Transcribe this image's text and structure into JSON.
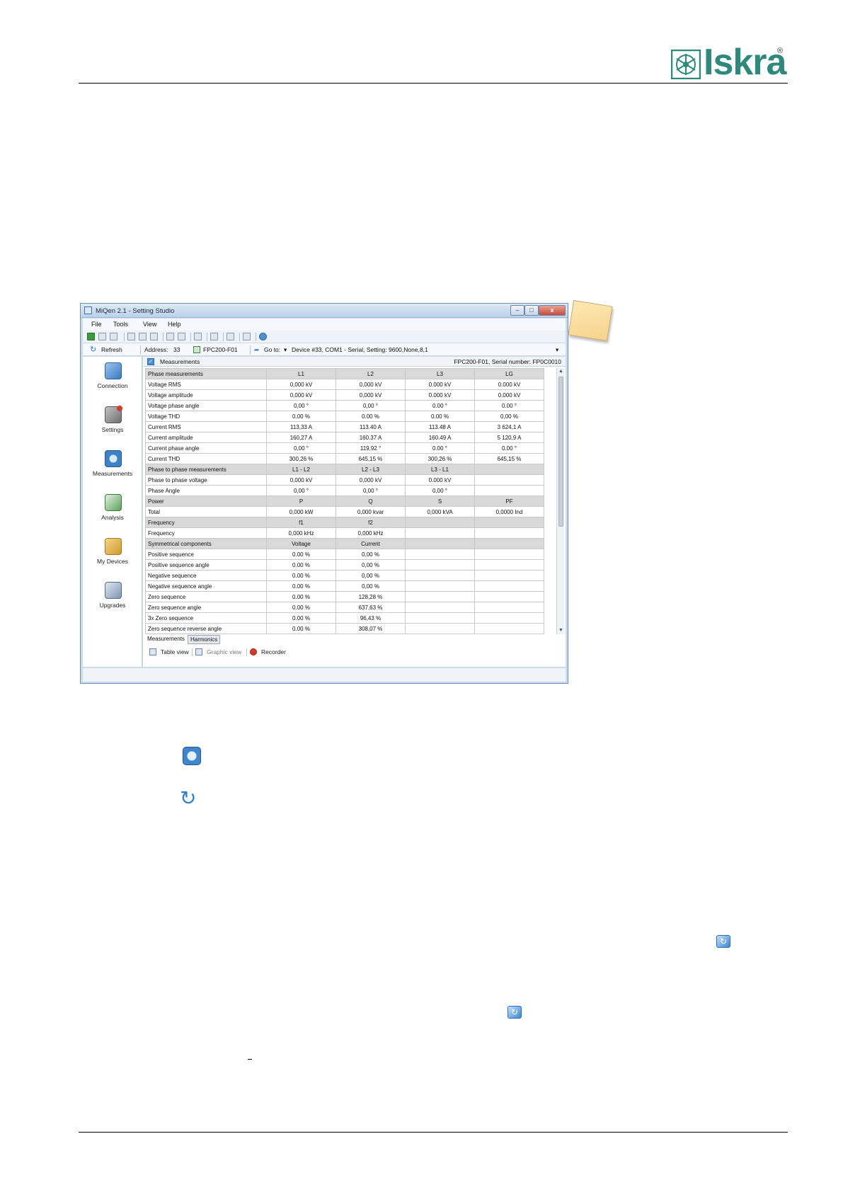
{
  "brand": {
    "name": "Iskra",
    "registered": "®",
    "color": "#2d8a7a"
  },
  "window": {
    "title": "MiQen 2.1 - Setting Studio",
    "buttons": {
      "minimize": "–",
      "maximize": "□",
      "close": "x"
    }
  },
  "menu": [
    "File",
    "Tools",
    "View",
    "Help"
  ],
  "addressbar": {
    "refresh": "Refresh",
    "address_label": "Address:",
    "address_value": "33",
    "device": "FPC200-F01",
    "goto_label": "Go to:",
    "goto_value": "Device #33, COM1 - Serial, Setting: 9600,None,8,1"
  },
  "sidebar": [
    {
      "label": "Connection",
      "icon": "connection-icon"
    },
    {
      "label": "Settings",
      "icon": "settings-icon"
    },
    {
      "label": "Measurements",
      "icon": "measurements-icon"
    },
    {
      "label": "Analysis",
      "icon": "analysis-icon"
    },
    {
      "label": "My Devices",
      "icon": "my-devices-icon"
    },
    {
      "label": "Upgrades",
      "icon": "upgrades-icon"
    }
  ],
  "panel": {
    "title": "Measurements",
    "serial": "FPC200-F01, Serial number: FP0C0010"
  },
  "table": {
    "rows": [
      {
        "type": "header",
        "cells": [
          "Phase measurements",
          "L1",
          "L2",
          "L3",
          "LG"
        ]
      },
      {
        "type": "data",
        "cells": [
          "Voltage RMS",
          "0,000 kV",
          "0,000 kV",
          "0.000 kV",
          "0.000 kV"
        ]
      },
      {
        "type": "data",
        "cells": [
          "Voltage amplitude",
          "0,000 kV",
          "0,000 kV",
          "0.000 kV",
          "0.000 kV"
        ]
      },
      {
        "type": "data",
        "cells": [
          "Voltage phase angle",
          "0,00 °",
          "0,00 °",
          "0.00 °",
          "0.00 °"
        ]
      },
      {
        "type": "data",
        "cells": [
          "Voltage THD",
          "0.00 %",
          "0.00 %",
          "0.00 %",
          "0,00 %"
        ]
      },
      {
        "type": "data",
        "cells": [
          "Current RMS",
          "113,33  A",
          "113.40  A",
          "113.48  A",
          "3 624,1  A"
        ]
      },
      {
        "type": "data",
        "cells": [
          "Current amplitude",
          "160,27  A",
          "160.37  A",
          "160.49  A",
          "5 120,9  A"
        ]
      },
      {
        "type": "data",
        "cells": [
          "Current phase angle",
          "0,00 °",
          "119,92 °",
          "0.00 °",
          "0.00 °"
        ]
      },
      {
        "type": "data",
        "cells": [
          "Current THD",
          "300,26 %",
          "645,15 %",
          "300,26 %",
          "645,15 %"
        ]
      },
      {
        "type": "header",
        "cells": [
          "Phase to phase measurements",
          "L1 - L2",
          "L2 - L3",
          "L3 - L1",
          ""
        ]
      },
      {
        "type": "data",
        "cells": [
          "Phase to phase voltage",
          "0,000 kV",
          "0,000 kV",
          "0.000 kV",
          ""
        ]
      },
      {
        "type": "data",
        "cells": [
          "Phase Angle",
          "0,00 °",
          "0,00 °",
          "0,00 °",
          ""
        ]
      },
      {
        "type": "header",
        "cells": [
          "Power",
          "P",
          "Q",
          "S",
          "PF"
        ]
      },
      {
        "type": "data",
        "cells": [
          "Total",
          "0,000 kW",
          "0,000 kvar",
          "0,000 kVA",
          "0,0000 Ind"
        ]
      },
      {
        "type": "header",
        "cells": [
          "Frequency",
          "f1",
          "f2",
          "",
          ""
        ]
      },
      {
        "type": "data",
        "cells": [
          "Frequency",
          "0,000 kHz",
          "0,000 kHz",
          "",
          ""
        ]
      },
      {
        "type": "header",
        "cells": [
          "Symmetrical components",
          "Voltage",
          "Current",
          "",
          ""
        ]
      },
      {
        "type": "data",
        "cells": [
          "Positive sequence",
          "0.00 %",
          "0,00 %",
          "",
          ""
        ]
      },
      {
        "type": "data",
        "cells": [
          "Positive sequence angle",
          "0.00 %",
          "0,00 %",
          "",
          ""
        ]
      },
      {
        "type": "data",
        "cells": [
          "Negative sequence",
          "0.00 %",
          "0,00 %",
          "",
          ""
        ]
      },
      {
        "type": "data",
        "cells": [
          "Negative sequence angle",
          "0.00 %",
          "0,00 %",
          "",
          ""
        ]
      },
      {
        "type": "data",
        "cells": [
          "Zero sequence",
          "0.00 %",
          "128,28 %",
          "",
          ""
        ]
      },
      {
        "type": "data",
        "cells": [
          "Zero sequence angle",
          "0.00 %",
          "637,63 %",
          "",
          ""
        ]
      },
      {
        "type": "data",
        "cells": [
          "3x Zero sequence",
          "0.00 %",
          "96,43 %",
          "",
          ""
        ]
      },
      {
        "type": "data",
        "cells": [
          "Zero sequence reverse angle",
          "0.00 %",
          "308,07 %",
          "",
          ""
        ]
      }
    ]
  },
  "tabs": {
    "active": "Measurements",
    "inactive": "Harmonics"
  },
  "viewbar": {
    "table": "Table view",
    "graphic": "Graphic view",
    "recorder": "Recorder"
  },
  "page_icons": [
    "measurements-icon",
    "refresh-icon",
    "refresh-icon",
    "refresh-icon"
  ]
}
